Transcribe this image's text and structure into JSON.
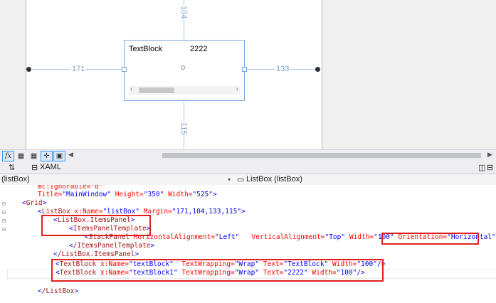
{
  "designer": {
    "dim_top": "104",
    "dim_left": "171",
    "dim_right": "133",
    "dim_bottom": "115",
    "listbox_item1": "TextBlock",
    "listbox_item2": "2222"
  },
  "toolbar": {
    "fx_label": "fx",
    "buttons": [
      "grid-small",
      "grid-large",
      "snap-lines",
      "snap-grid"
    ]
  },
  "tabs": {
    "swap_label": "⇅",
    "xaml_label": "XAML"
  },
  "navbar": {
    "left_scope": "(listBox)",
    "right_scope": "ListBox (listBox)"
  },
  "code": {
    "line0": "mc:Ignorable=\"d\"",
    "line1_attr1": "Title=",
    "line1_val1": "\"MainWindow\"",
    "line1_attr2": " Height=",
    "line1_val2": "\"350\"",
    "line1_attr3": " Width=",
    "line1_val3": "\"525\"",
    "line1_end": ">",
    "line2": "Grid",
    "line3_tag": "ListBox",
    "line3_attr1": " x:Name=",
    "line3_val1": "\"listBox\"",
    "line3_attr2": " Margin=",
    "line3_val2": "\"171,104,133,115\"",
    "line4_tag": "ListBox.ItemsPanel",
    "line5_tag": "ItemsPanelTemplate",
    "line6_tag": "StackPanel",
    "line6_attr1": " HorizontalAlignment=",
    "line6_val1": "\"Left\"",
    "line6_attr2": "   VerticalAlignment=",
    "line6_val2": "\"Top\"",
    "line6_attr3": " Width=",
    "line6_val3": "\"100\"",
    "line6_attr4": "Orientation=",
    "line6_val4": "\"Horizontal\"",
    "line7_tag": "/ItemsPanelTemplate",
    "line8_tag": "/ListBox.ItemsPanel",
    "line9_tag": "TextBlock",
    "line9_attr1": " x:Name=",
    "line9_val1": "\"textBlock\"",
    "line9_attr2": "  TextWrapping=",
    "line9_val2": "\"Wrap\"",
    "line9_attr3": " Text=",
    "line9_val3": "\"TextBlock\"",
    "line9_attr4": " Width=",
    "line9_val4": "\"100\"",
    "line10_tag": "TextBlock",
    "line10_attr1": " x:Name=",
    "line10_val1": "\"textBlock1\"",
    "line10_attr2": " TextWrapping=",
    "line10_val2": "\"Wrap\"",
    "line10_attr3": " Text=",
    "line10_val3": "\"2222\"",
    "line10_attr4": " Width=",
    "line10_val4": "\"100\"",
    "line12_tag": "/ListBox"
  }
}
